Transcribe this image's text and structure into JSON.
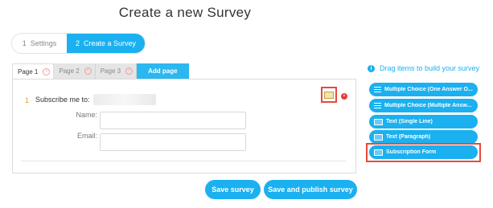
{
  "title": "Create a new Survey",
  "steps": [
    {
      "num": "1",
      "label": "Settings"
    },
    {
      "num": "2",
      "label": "Create a Survey"
    }
  ],
  "page_tabs": [
    {
      "label": "Page 1"
    },
    {
      "label": "Page 2"
    },
    {
      "label": "Page 3"
    }
  ],
  "add_page_label": "Add page",
  "question": {
    "number": "1",
    "label": "Subscribe me to:",
    "fields": [
      {
        "label": "Name:"
      },
      {
        "label": "Email:"
      }
    ]
  },
  "buttons": {
    "save": "Save survey",
    "save_publish": "Save and publish survey"
  },
  "sidebar": {
    "hint": "Drag items to build your survey",
    "items": [
      {
        "label": "Multiple Choice (One Answer O...",
        "icon": "list-icon"
      },
      {
        "label": "Multiple Choice (Multiple Answ...",
        "icon": "list-icon"
      },
      {
        "label": "Text (Single Line)",
        "icon": "text-field-icon"
      },
      {
        "label": "Text (Paragraph)",
        "icon": "text-field-icon"
      },
      {
        "label": "Subscription Form",
        "icon": "form-icon"
      }
    ]
  },
  "colors": {
    "accent": "#1bb0f0",
    "highlight": "#e8493c",
    "delete": "#e63a3a",
    "question_number": "#e89a2d"
  }
}
